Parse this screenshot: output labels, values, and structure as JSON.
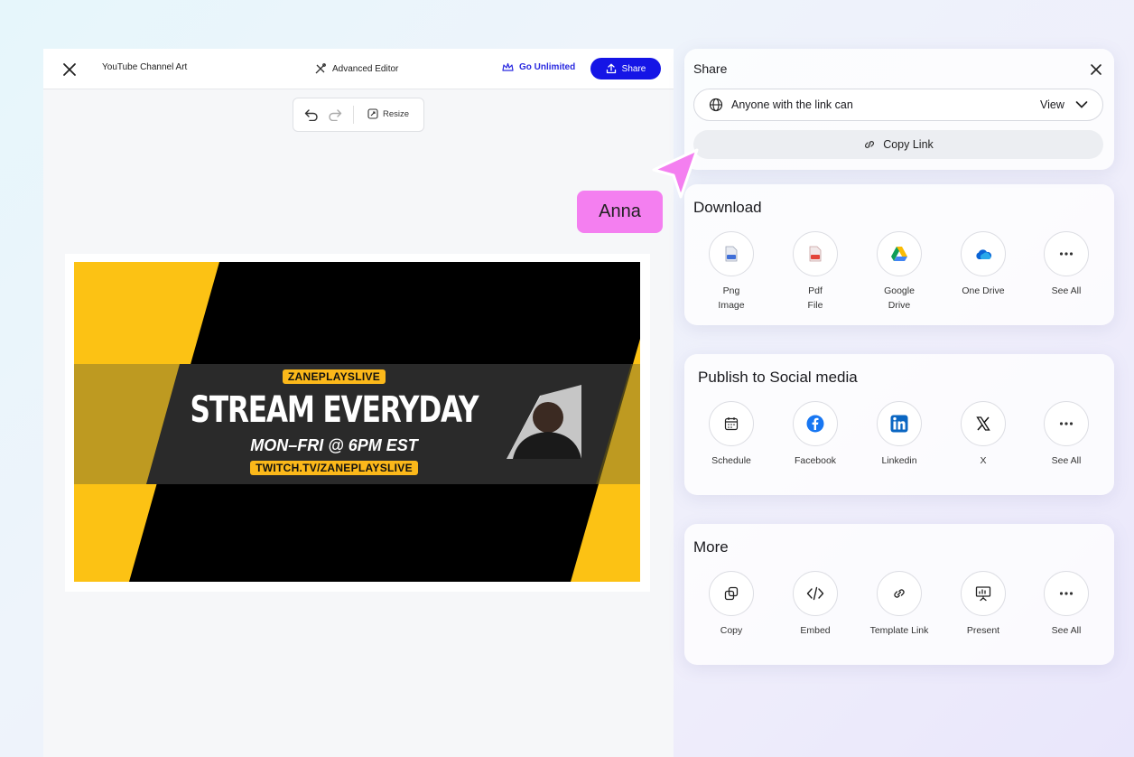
{
  "editor": {
    "doc_title": "YouTube Channel Art",
    "advanced_editor": "Advanced Editor",
    "go_unlimited": "Go Unlimited",
    "share_button": "Share",
    "resize": "Resize"
  },
  "banner": {
    "channel": "ZANEPLAYSLIVE",
    "headline": "STREAM EVERYDAY",
    "schedule": "MON–FRI @ 6PM EST",
    "url": "TWITCH.TV/ZANEPLAYSLIVE"
  },
  "cursor": {
    "name": "Anna",
    "color": "#f47ff0"
  },
  "share": {
    "title": "Share",
    "access_text": "Anyone with the link can",
    "access_level": "View",
    "copy_link": "Copy Link"
  },
  "download": {
    "title": "Download",
    "items": [
      {
        "label": "Png\nImage",
        "icon": "png-file-icon"
      },
      {
        "label": "Pdf\nFile",
        "icon": "pdf-file-icon"
      },
      {
        "label": "Google\nDrive",
        "icon": "google-drive-icon"
      },
      {
        "label": "One Drive",
        "icon": "onedrive-icon"
      },
      {
        "label": "See All",
        "icon": "more-icon"
      }
    ]
  },
  "social": {
    "title": "Publish to Social media",
    "items": [
      {
        "label": "Schedule",
        "icon": "calendar-icon"
      },
      {
        "label": "Facebook",
        "icon": "facebook-icon"
      },
      {
        "label": "Linkedin",
        "icon": "linkedin-icon"
      },
      {
        "label": "X",
        "icon": "x-icon"
      },
      {
        "label": "See All",
        "icon": "more-icon"
      }
    ]
  },
  "more": {
    "title": "More",
    "items": [
      {
        "label": "Copy",
        "icon": "copy-icon"
      },
      {
        "label": "Embed",
        "icon": "code-icon"
      },
      {
        "label": "Template Link",
        "icon": "link-icon"
      },
      {
        "label": "Present",
        "icon": "presentation-icon"
      },
      {
        "label": "See All",
        "icon": "more-icon"
      }
    ]
  },
  "colors": {
    "primary": "#1515e6",
    "banner_yellow": "#fcc214",
    "facebook": "#1877f2",
    "linkedin": "#0a66c2"
  }
}
